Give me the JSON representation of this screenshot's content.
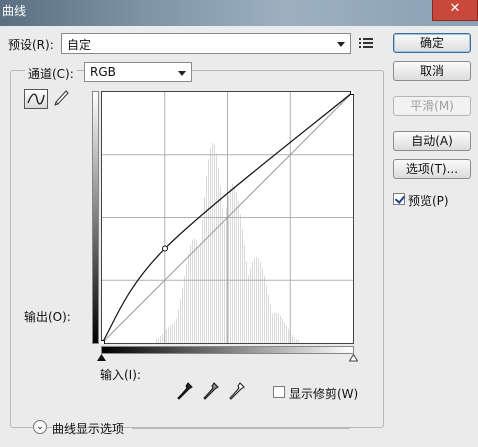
{
  "window": {
    "title": "曲线",
    "close_glyph": "✕"
  },
  "preset": {
    "label": "预设(R):",
    "value": "自定",
    "menu_icon": "list-menu-icon"
  },
  "channel": {
    "label": "通道(C):",
    "value": "RGB"
  },
  "buttons": {
    "ok": "确定",
    "cancel": "取消",
    "smooth": "平滑(M)",
    "auto": "自动(A)",
    "options": "选项(T)..."
  },
  "preview": {
    "label": "预览(P)",
    "checked": true
  },
  "tools": {
    "curve_tool_icon": "curve-tool-icon",
    "pencil_tool_icon": "pencil-icon"
  },
  "axes": {
    "output_label": "输出(O):",
    "input_label": "输入(I):"
  },
  "clipping": {
    "label": "显示修剪(W)",
    "checked": false
  },
  "eyedroppers": [
    "black-point-eyedropper-icon",
    "gray-point-eyedropper-icon",
    "white-point-eyedropper-icon"
  ],
  "display_options": {
    "label": "曲线显示选项"
  },
  "curve": {
    "points": [
      [
        0,
        0
      ],
      [
        64,
        96
      ],
      [
        255,
        255
      ]
    ],
    "histogram_color": "#d9d9d9",
    "line_color": "#111111"
  }
}
